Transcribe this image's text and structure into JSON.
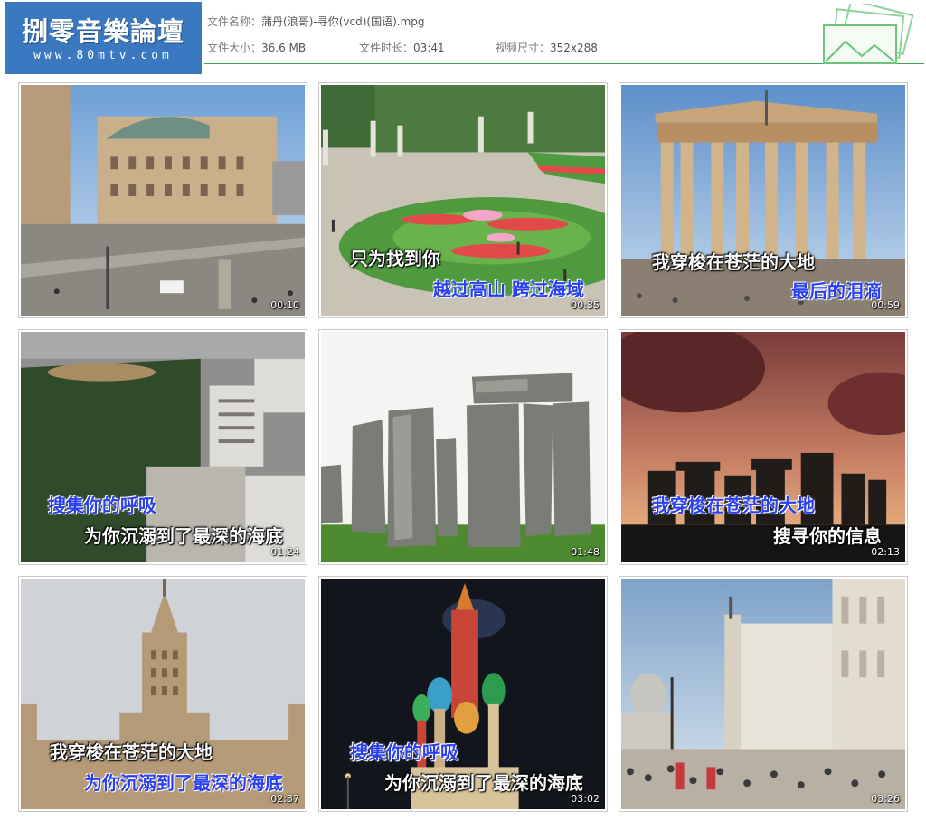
{
  "header": {
    "logo_text": "捌零音樂論壇",
    "logo_url": "www.80mtv.com",
    "file_name_label": "文件名称：",
    "file_name": "蒲丹(浪哥)-寻你(vcd)(国语).mpg",
    "file_size_label": "文件大小：",
    "file_size": "36.6 MB",
    "duration_label": "文件时长：",
    "duration": "03:41",
    "dimensions_label": "视频尺寸：",
    "dimensions": "352x288",
    "accent_color": "#3aa64a",
    "logo_color": "#3a78c0"
  },
  "thumbnails": [
    {
      "scene": "vienna-opera-street",
      "timestamp": "00:10",
      "lyric_line1": "",
      "lyric_line2": ""
    },
    {
      "scene": "palace-garden",
      "timestamp": "00:35",
      "lyric_line1": "只为找到你",
      "lyric_line2": "越过高山 跨过海域"
    },
    {
      "scene": "parthenon",
      "timestamp": "00:59",
      "lyric_line1": "我穿梭在苍茫的大地",
      "lyric_line2": "最后的泪滴"
    },
    {
      "scene": "aerial-city",
      "timestamp": "01:24",
      "lyric_line1": "搜集你的呼吸",
      "lyric_line2": "为你沉溺到了最深的海底"
    },
    {
      "scene": "stonehenge-day",
      "timestamp": "01:48",
      "lyric_line1": "",
      "lyric_line2": ""
    },
    {
      "scene": "stonehenge-sunset",
      "timestamp": "02:13",
      "lyric_line1": "我穿梭在苍茫的大地",
      "lyric_line2": "搜寻你的信息"
    },
    {
      "scene": "moscow-university",
      "timestamp": "02:37",
      "lyric_line1": "我穿梭在苍茫的大地",
      "lyric_line2": "为你沉溺到了最深的海底"
    },
    {
      "scene": "st-basils-night",
      "timestamp": "03:02",
      "lyric_line1": "搜集你的呼吸",
      "lyric_line2": "为你沉溺到了最深的海底"
    },
    {
      "scene": "venice-piazza",
      "timestamp": "03:26",
      "lyric_line1": "",
      "lyric_line2": ""
    }
  ]
}
